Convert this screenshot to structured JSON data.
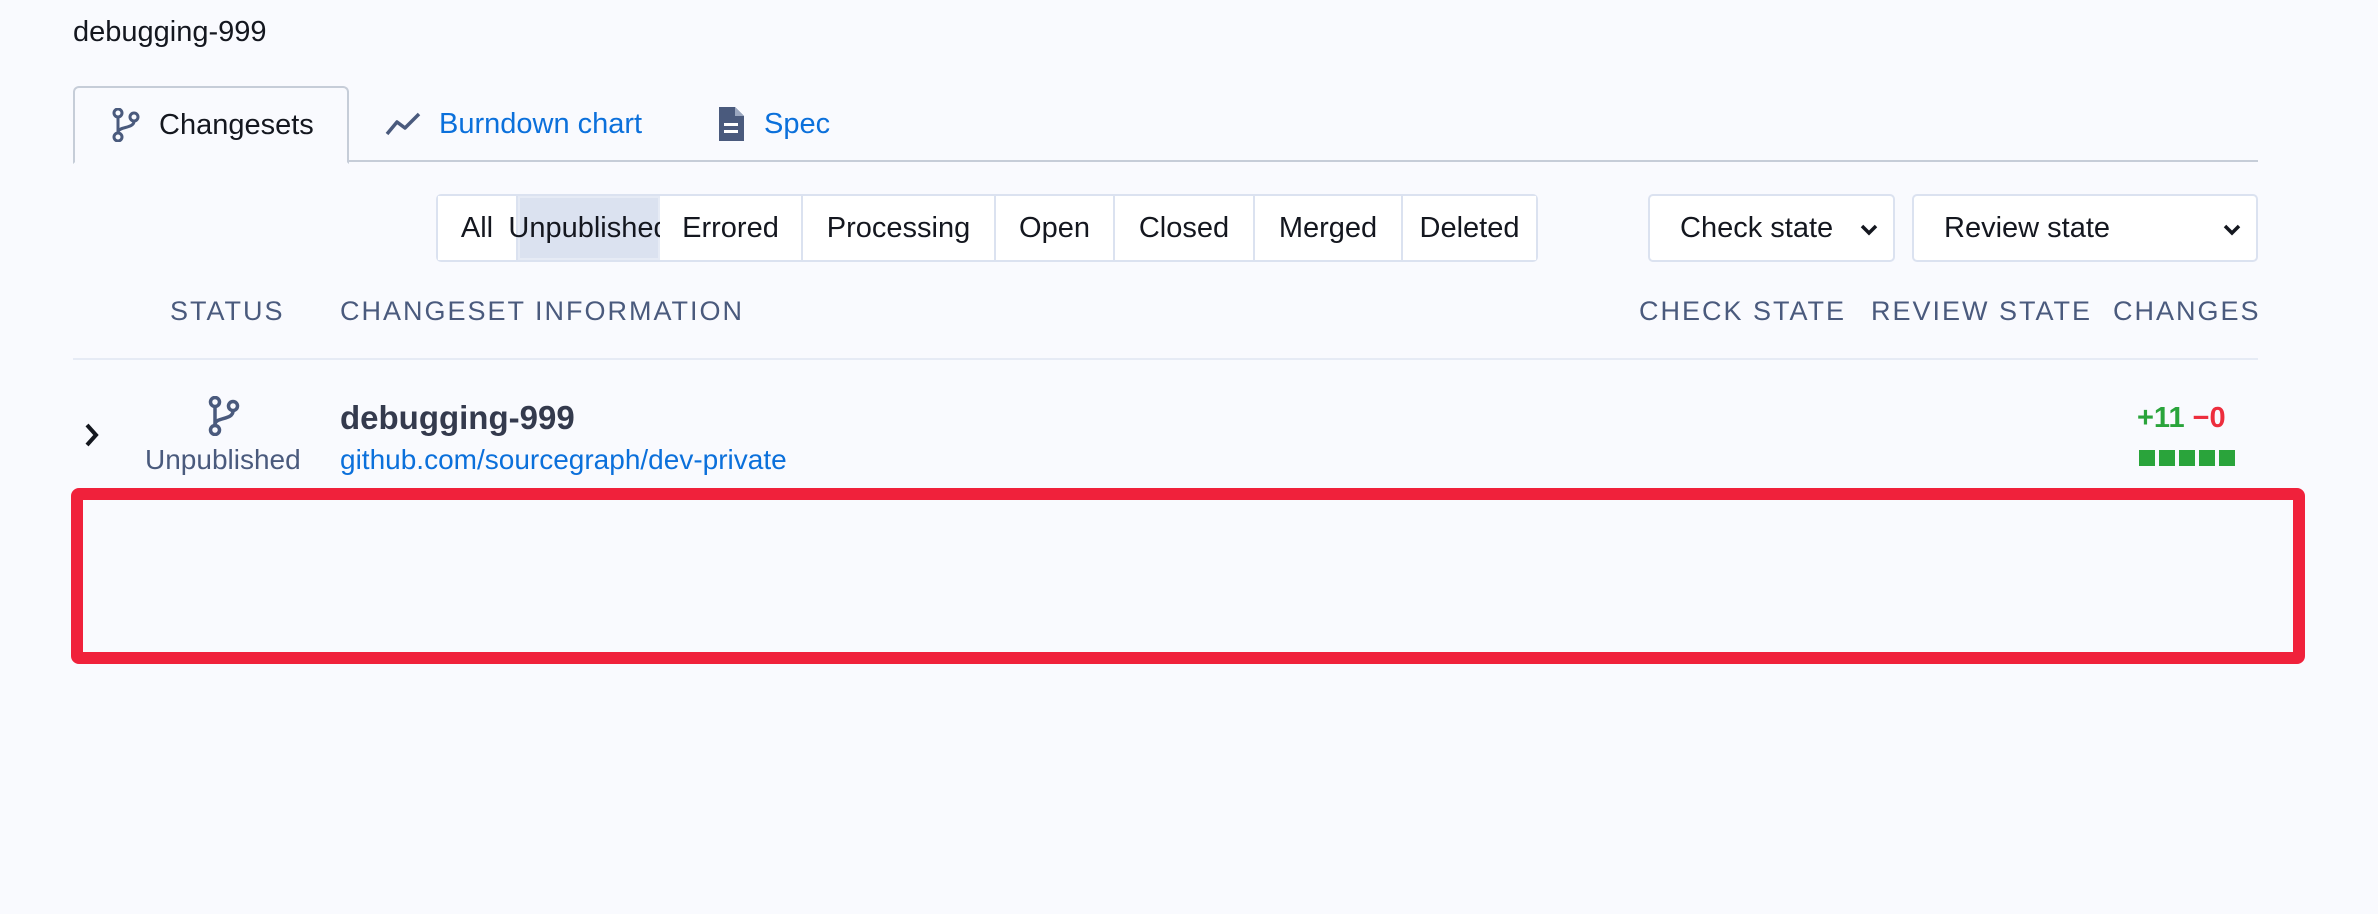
{
  "breadcrumb": {
    "title": "debugging-999"
  },
  "tabs": [
    {
      "label": "Changesets",
      "icon": "branch-icon",
      "active": true
    },
    {
      "label": "Burndown chart",
      "icon": "chart-line-icon",
      "active": false
    },
    {
      "label": "Spec",
      "icon": "file-document-icon",
      "active": false
    }
  ],
  "filters": [
    "All",
    "Unpublished",
    "Errored",
    "Processing",
    "Open",
    "Closed",
    "Merged",
    "Deleted"
  ],
  "selected_filter": "Unpublished",
  "selects": {
    "check_state": "Check state",
    "review_state": "Review state"
  },
  "columns": {
    "status": "STATUS",
    "info": "CHANGESET INFORMATION",
    "check": "CHECK STATE",
    "review": "REVIEW STATE",
    "changes": "CHANGES"
  },
  "changeset": {
    "status": "Unpublished",
    "title": "debugging-999",
    "repo": "github.com/sourcegraph/dev-private",
    "added": "+11",
    "deleted": "−0"
  },
  "colors": {
    "link": "#0b70db",
    "added": "#2aa43b",
    "deleted": "#ed2d3d",
    "highlight": "#f0213b"
  }
}
